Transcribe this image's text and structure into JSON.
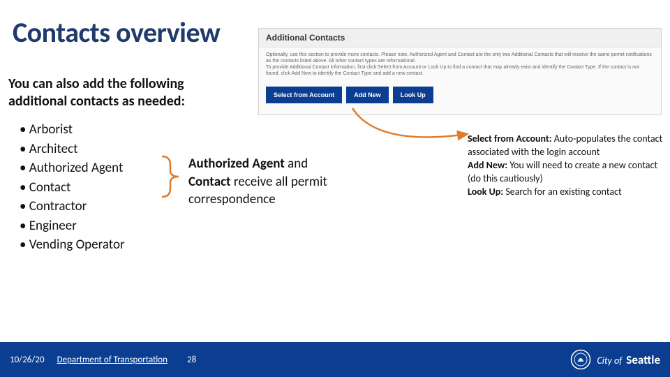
{
  "title": "Contacts overview",
  "intro": "You can also add the following additional contacts as needed:",
  "bullets": [
    "Arborist",
    "Architect",
    "Authorized Agent",
    "Contact",
    "Contractor",
    "Engineer",
    "Vending Operator"
  ],
  "bracket_note": {
    "b1": "Authorized Agent",
    "mid1": " and ",
    "b2": "Contact",
    "mid2": " receive all permit correspondence"
  },
  "screenshot": {
    "header": "Additional Contacts",
    "body_line1": "Optionally, use this section to provide more contacts. Please note, Authorized Agent and Contact are the only two Additional Contacts that will receive the same permit notifications as the contacts listed above. All other contact types are informational.",
    "body_line2": "To provide Additional Contact information, first click Select from Account or Look Up to find a contact that may already exist and identify the Contact Type. If the contact is not found, click Add New to identify the Contact Type and add a new contact.",
    "btn1": "Select from Account",
    "btn2": "Add New",
    "btn3": "Look Up"
  },
  "actions": {
    "a1_label": "Select from Account:",
    "a1_desc": " Auto-populates the contact associated with the login account",
    "a2_label": "Add New:",
    "a2_desc": " You will need to create a new contact (do this cautiously)",
    "a3_label": "Look Up:",
    "a3_desc": " Search for an existing contact"
  },
  "footer": {
    "date": "10/26/20",
    "dept": "Department of Transportation",
    "page": "28",
    "logo_prefix": "City of",
    "logo_name": "Seattle"
  },
  "colors": {
    "primary": "#0b3d91",
    "accent": "#e07b2e"
  }
}
